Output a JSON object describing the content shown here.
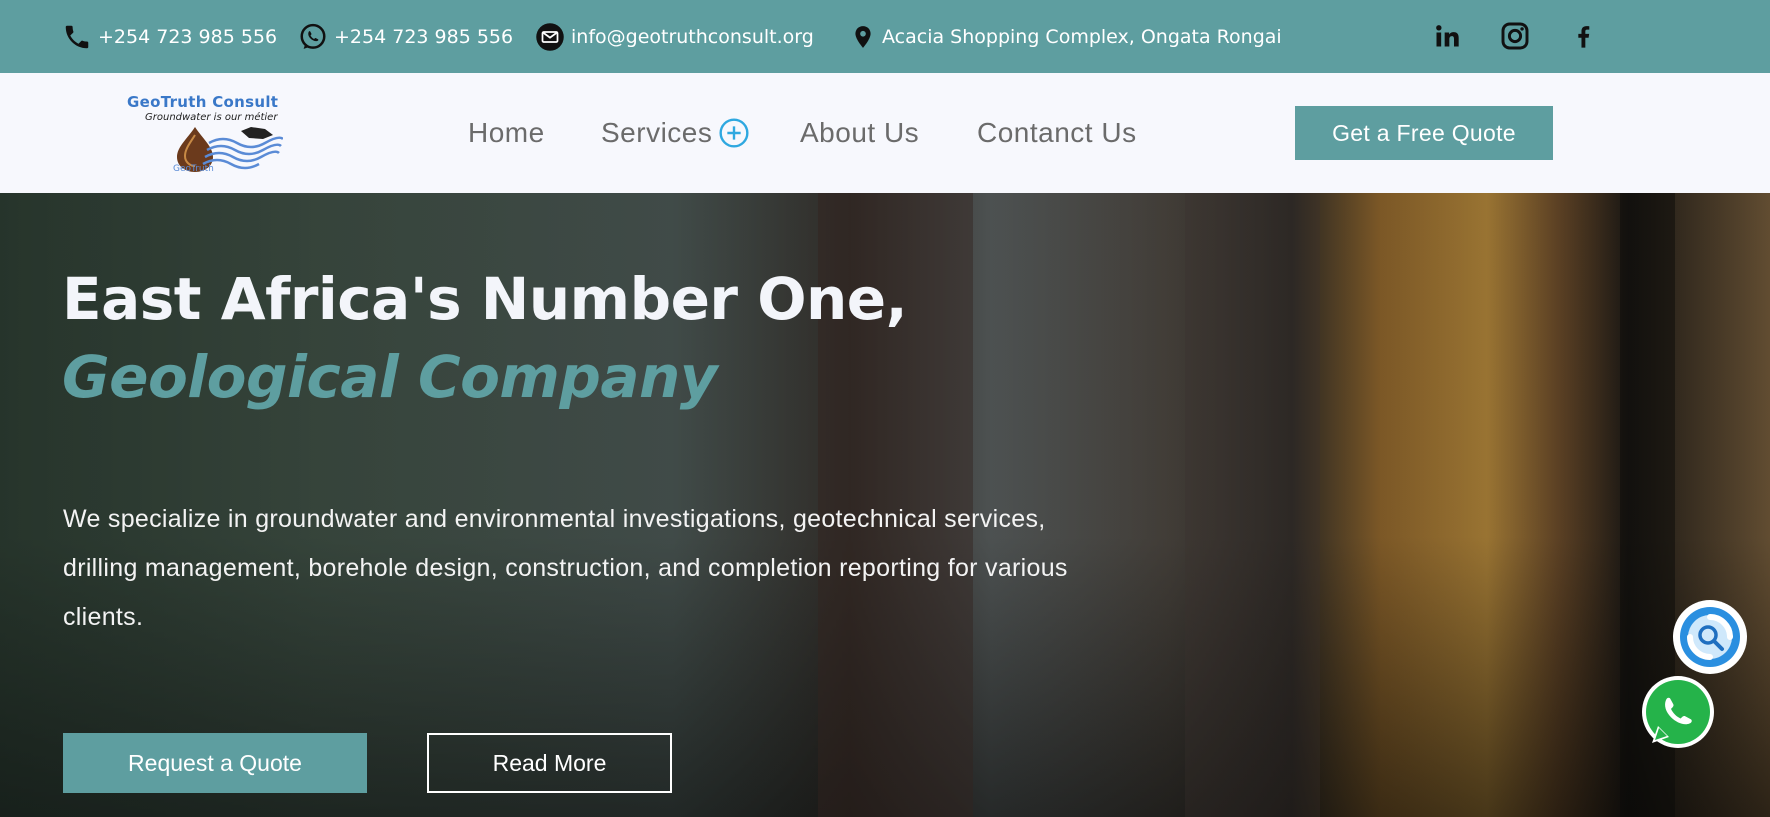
{
  "topbar": {
    "phone": "+254 723 985 556",
    "whatsapp": "+254 723 985 556",
    "email": "info@geotruthconsult.org",
    "address": "Acacia Shopping Complex, Ongata Rongai",
    "icons": [
      "phone-icon",
      "whatsapp-icon",
      "mail-icon",
      "location-pin-icon",
      "linkedin-icon",
      "instagram-icon",
      "facebook-icon"
    ]
  },
  "logo": {
    "title": "GeoTruth Consult",
    "tagline": "Groundwater is our métier",
    "sub": "GeoTruth"
  },
  "nav": {
    "home": "Home",
    "services": "Services",
    "about": "About Us",
    "contact": "Contanct Us",
    "quote_button": "Get a Free Quote"
  },
  "hero": {
    "title_line1": "East Africa's Number One,",
    "title_line2": "Geological Company",
    "description": "We specialize in groundwater and environmental investigations, geotechnical services, drilling management, borehole design, construction, and completion reporting for various clients.",
    "request_button": "Request a Quote",
    "read_more_button": "Read More"
  },
  "colors": {
    "accent": "#5e9ea0",
    "nav_bg": "#f7f8fd",
    "nav_text": "#6b6b6b",
    "hero_text": "#f3f5fa"
  }
}
